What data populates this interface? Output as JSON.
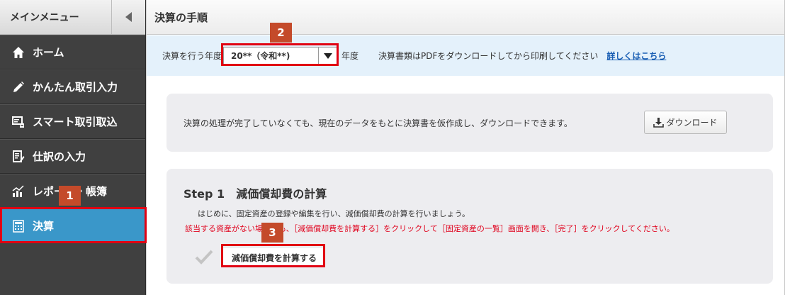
{
  "sidebar": {
    "title": "メインメニュー",
    "collapse_icon": "chevron-left-icon",
    "items": [
      {
        "label": "ホーム",
        "icon": "home-icon"
      },
      {
        "label": "かんたん取引入力",
        "icon": "pencil-icon"
      },
      {
        "label": "スマート取引取込",
        "icon": "import-icon"
      },
      {
        "label": "仕訳の入力",
        "icon": "journal-icon"
      },
      {
        "label": "レポート・帳簿",
        "icon": "chart-icon"
      },
      {
        "label": "決算",
        "icon": "calculator-icon",
        "active": true
      }
    ]
  },
  "header": {
    "title": "決算の手順"
  },
  "yearbar": {
    "label": "決算を行う年度",
    "selected_year": "20**（令和**)",
    "suffix": "年度",
    "note": "決算書類はPDFをダウンロードしてから印刷してください",
    "link": "詳しくはこちら"
  },
  "download_panel": {
    "message": "決算の処理が完了していなくても、現在のデータをもとに決算書を仮作成し、ダウンロードできます。",
    "button": "ダウンロード"
  },
  "step1": {
    "number": "Step 1",
    "title": "減価償却費の計算",
    "description": "はじめに、固定資産の登録や編集を行い、減価償却費の計算を行いましょう。",
    "warning": "該当する資産がない場合でも、［減価償却費を計算する］をクリックして［固定資産の一覧］画面を開き、［完了］をクリックしてください。",
    "button": "減価償却費を計算する"
  },
  "annotations": {
    "badge1": "1",
    "badge2": "2",
    "badge3": "3"
  },
  "colors": {
    "accent": "#3a97c9",
    "highlight": "#e10012",
    "badge": "#c44a2a",
    "warning": "#e0001b"
  }
}
